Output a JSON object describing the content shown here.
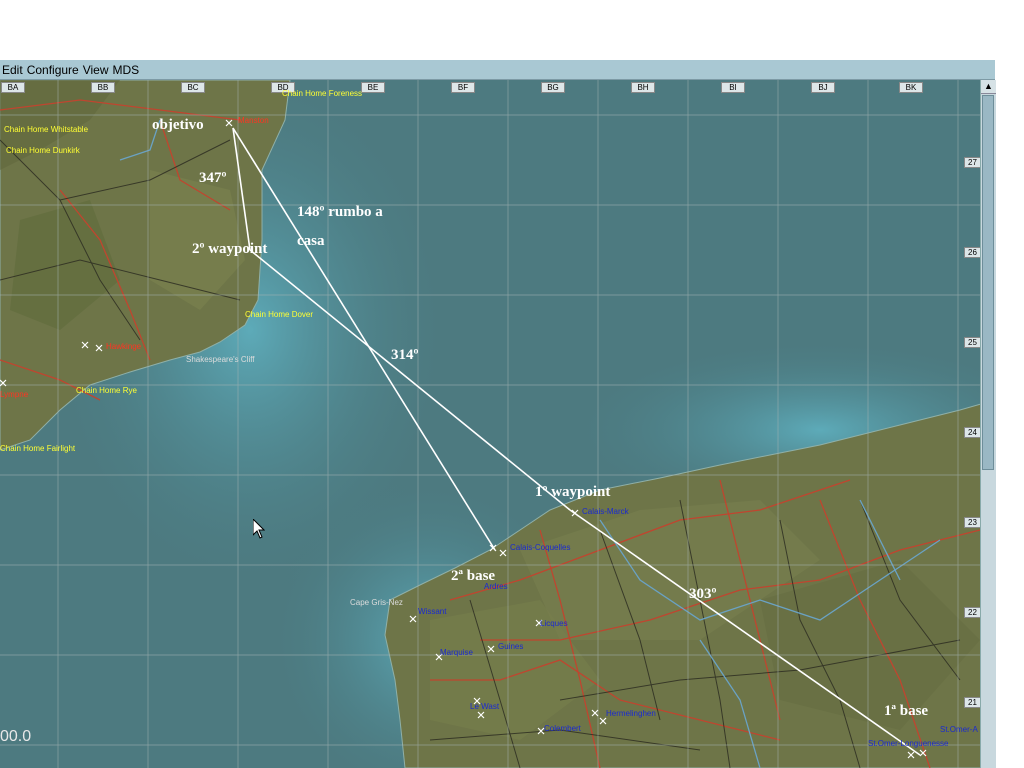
{
  "menu": {
    "items": [
      "Edit",
      "Configure",
      "View",
      "MDS"
    ]
  },
  "grid": {
    "columns": [
      "BA",
      "BB",
      "BC",
      "BD",
      "BE",
      "BF",
      "BG",
      "BH",
      "BI",
      "BJ",
      "BK"
    ],
    "rows": [
      "27",
      "26",
      "25",
      "24",
      "23",
      "22",
      "21"
    ]
  },
  "annotations": {
    "objective": "objetivo",
    "heading_347": "347º",
    "heading_148_line1": "148º rumbo a",
    "heading_148_line2": "casa",
    "waypoint_2": "2º waypoint",
    "heading_314": "314º",
    "waypoint_1": "1º waypoint",
    "base_2": "2ª base",
    "heading_303": "303º",
    "base_1": "1ª base"
  },
  "places": {
    "radar": [
      "Chain Home Foreness",
      "Chain Home Whitstable",
      "Chain Home Dunkirk",
      "Chain Home Dover",
      "Chain Home Rye",
      "Chain Home Fairlight"
    ],
    "red": [
      "Manston",
      "Lympne",
      "Hawkinge"
    ],
    "white": [
      "Shakespeare's Cliff",
      "Cape Gris-Nez"
    ],
    "blue": [
      "Calais-Marck",
      "Calais-Coquelles",
      "Marquise",
      "Wissant",
      "Guines",
      "Ardres",
      "Licques",
      "Le Wast",
      "Colembert",
      "Hermelinghen",
      "St.Omer-A",
      "St.Omer-Longuenesse"
    ]
  },
  "status": {
    "coord_readout": "00.0"
  },
  "colors": {
    "land": "#6b7146",
    "sea": "#497d84",
    "coast_sea": "#4f9aa8",
    "road": "#c14a36",
    "river": "#6aa2c4",
    "grid": "#9aa6a6"
  }
}
